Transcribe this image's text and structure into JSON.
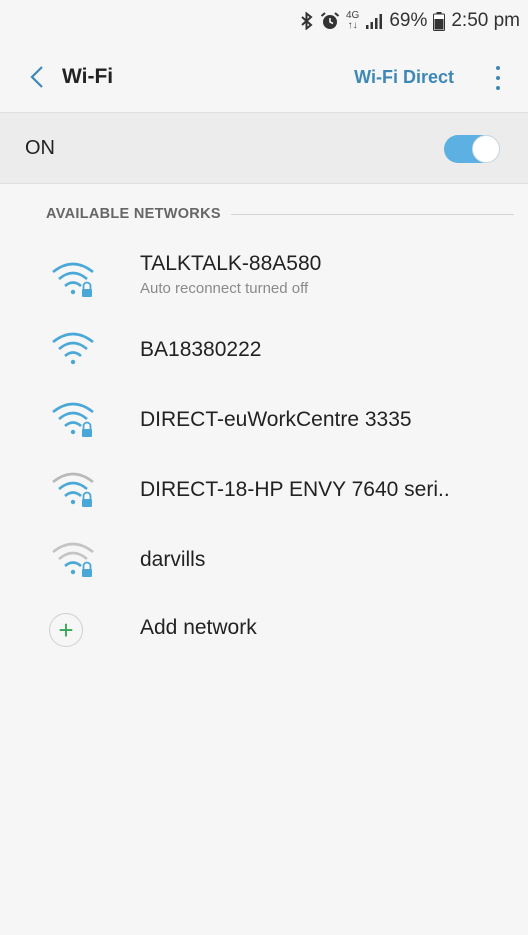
{
  "status_bar": {
    "network_type": "4G",
    "network_sub": "↑↓",
    "battery_percent": "69%",
    "time": "2:50 pm"
  },
  "app_bar": {
    "title": "Wi-Fi",
    "wifi_direct_label": "Wi-Fi Direct"
  },
  "master_switch": {
    "label": "ON",
    "checked": true
  },
  "section": {
    "title": "AVAILABLE NETWORKS"
  },
  "networks": [
    {
      "name": "TALKTALK-88A580",
      "subtitle": "Auto reconnect turned off",
      "locked": true,
      "strength": "strong"
    },
    {
      "name": "BA18380222",
      "subtitle": "",
      "locked": false,
      "strength": "strong"
    },
    {
      "name": "DIRECT-euWorkCentre 3335",
      "subtitle": "",
      "locked": true,
      "strength": "strong"
    },
    {
      "name": "DIRECT-18-HP ENVY 7640 seri..",
      "subtitle": "",
      "locked": true,
      "strength": "medium"
    },
    {
      "name": "darvills",
      "subtitle": "",
      "locked": true,
      "strength": "weak"
    }
  ],
  "add_network": {
    "label": "Add network",
    "icon": "+"
  },
  "colors": {
    "accent": "#3e88b6",
    "wifi_strong": "#4aa8d8",
    "wifi_weak": "#b4b4b4",
    "toggle_on": "#5cb0e2",
    "add_icon": "#34a853"
  }
}
